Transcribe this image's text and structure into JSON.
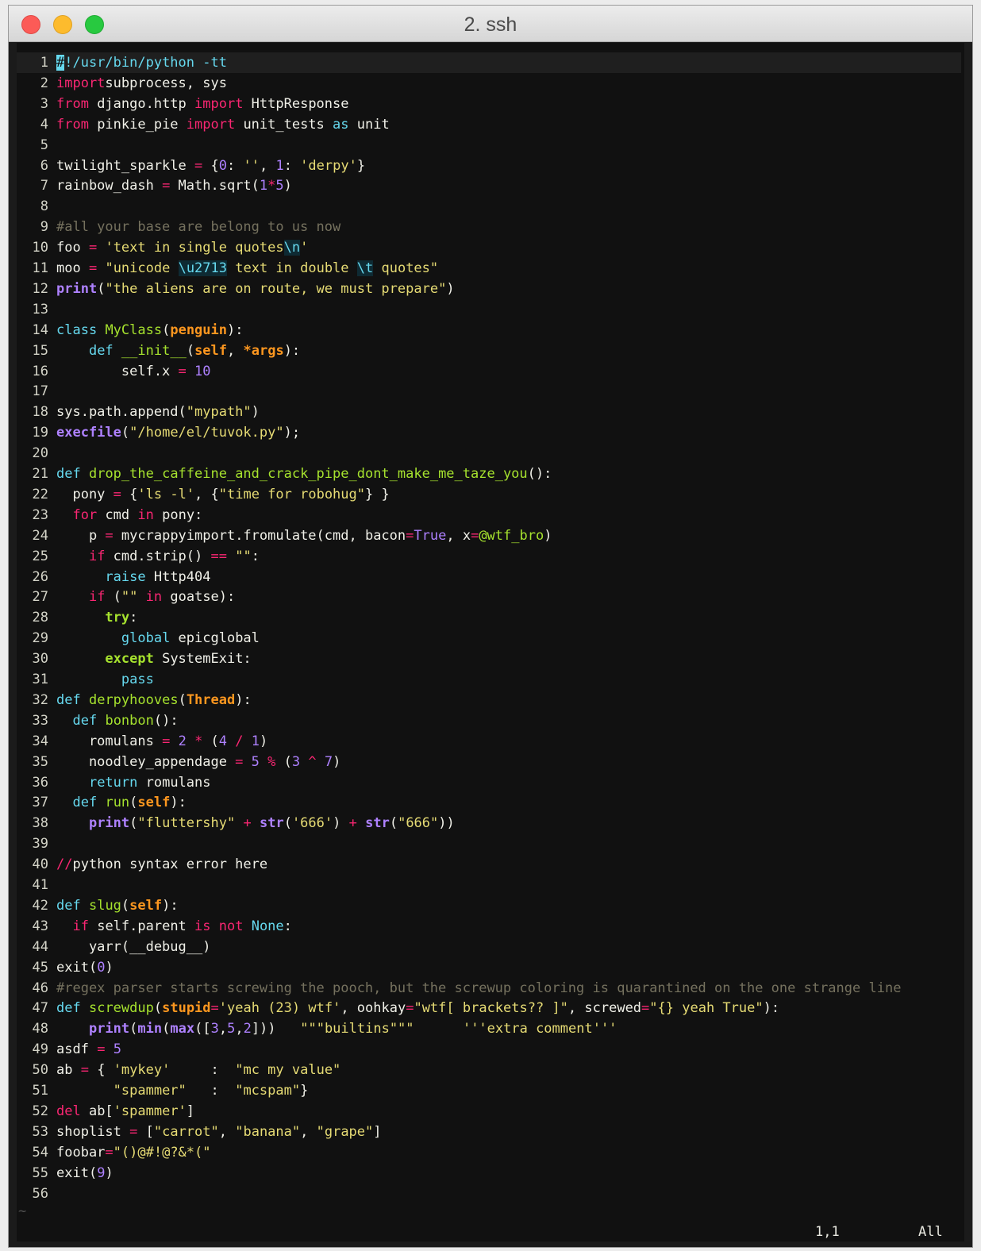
{
  "window": {
    "title": "2. ssh"
  },
  "editor": {
    "status_position": "1,1",
    "status_scroll": "All",
    "empty_line_marker": "~",
    "lines": [
      [
        [
          "k",
          "#"
        ],
        [
          "b",
          "!/usr/bin/python -tt"
        ]
      ],
      [
        [
          "k",
          "import"
        ],
        [
          "",
          "subprocess, sys"
        ]
      ],
      [
        [
          "k",
          "from"
        ],
        [
          "",
          " django.http "
        ],
        [
          "k",
          "import"
        ],
        [
          "",
          " HttpResponse"
        ]
      ],
      [
        [
          "k",
          "from"
        ],
        [
          "",
          " pinkie_pie "
        ],
        [
          "k",
          "import"
        ],
        [
          "",
          " unit_tests "
        ],
        [
          "b",
          "as"
        ],
        [
          "",
          " unit"
        ]
      ],
      [],
      [
        [
          "",
          "twilight_sparkle "
        ],
        [
          "k",
          "="
        ],
        [
          "",
          " {"
        ],
        [
          "p",
          "0"
        ],
        [
          "",
          ": "
        ],
        [
          "s",
          "''"
        ],
        [
          "",
          ", "
        ],
        [
          "p",
          "1"
        ],
        [
          "",
          ": "
        ],
        [
          "s",
          "'derpy'"
        ],
        [
          "",
          "}"
        ]
      ],
      [
        [
          "",
          "rainbow_dash "
        ],
        [
          "k",
          "="
        ],
        [
          "",
          " Math.sqrt("
        ],
        [
          "p",
          "1"
        ],
        [
          "k",
          "*"
        ],
        [
          "p",
          "5"
        ],
        [
          "",
          ")"
        ]
      ],
      [],
      [
        [
          "c",
          "#all your base are belong to us now"
        ]
      ],
      [
        [
          "",
          "foo "
        ],
        [
          "k",
          "="
        ],
        [
          "",
          " "
        ],
        [
          "s",
          "'text in single quotes"
        ],
        [
          "esc",
          "\\n"
        ],
        [
          "s",
          "'"
        ]
      ],
      [
        [
          "",
          "moo "
        ],
        [
          "k",
          "="
        ],
        [
          "",
          " "
        ],
        [
          "s",
          "\"unicode "
        ],
        [
          "esc",
          "\\u2713"
        ],
        [
          "s",
          " text in double "
        ],
        [
          "esc",
          "\\t"
        ],
        [
          "s",
          " quotes\""
        ]
      ],
      [
        [
          "bp",
          "print"
        ],
        [
          "",
          "("
        ],
        [
          "s",
          "\"the aliens are on route, we must prepare\""
        ],
        [
          "",
          ")"
        ]
      ],
      [],
      [
        [
          "b",
          "class"
        ],
        [
          "",
          " "
        ],
        [
          "g",
          "MyClass"
        ],
        [
          "",
          "("
        ],
        [
          "o",
          "penguin"
        ],
        [
          "",
          "):"
        ]
      ],
      [
        [
          "",
          "    "
        ],
        [
          "b",
          "def"
        ],
        [
          "",
          " "
        ],
        [
          "g",
          "__init__"
        ],
        [
          "",
          "("
        ],
        [
          "o",
          "self"
        ],
        [
          "",
          ", "
        ],
        [
          "o",
          "*args"
        ],
        [
          "",
          "):"
        ]
      ],
      [
        [
          "",
          "        self.x "
        ],
        [
          "k",
          "="
        ],
        [
          "",
          " "
        ],
        [
          "p",
          "10"
        ]
      ],
      [],
      [
        [
          "",
          "sys.path.append("
        ],
        [
          "s",
          "\"mypath\""
        ],
        [
          "",
          ")"
        ]
      ],
      [
        [
          "bp",
          "execfile"
        ],
        [
          "",
          "("
        ],
        [
          "s",
          "\"/home/el/tuvok.py\""
        ],
        [
          "",
          ");"
        ]
      ],
      [],
      [
        [
          "b",
          "def"
        ],
        [
          "",
          " "
        ],
        [
          "g",
          "drop_the_caffeine_and_crack_pipe_dont_make_me_taze_you"
        ],
        [
          "",
          "():"
        ]
      ],
      [
        [
          "",
          "  pony "
        ],
        [
          "k",
          "="
        ],
        [
          "",
          " {"
        ],
        [
          "s",
          "'ls -l'"
        ],
        [
          "",
          ", {"
        ],
        [
          "s",
          "\"time for robohug\""
        ],
        [
          "",
          "} }"
        ]
      ],
      [
        [
          "",
          "  "
        ],
        [
          "k",
          "for"
        ],
        [
          "",
          " cmd "
        ],
        [
          "k",
          "in"
        ],
        [
          "",
          " pony:"
        ]
      ],
      [
        [
          "",
          "    p "
        ],
        [
          "k",
          "="
        ],
        [
          "",
          " mycrappyimport.fromulate(cmd, bacon"
        ],
        [
          "k",
          "="
        ],
        [
          "p",
          "True"
        ],
        [
          "",
          ", x"
        ],
        [
          "k",
          "="
        ],
        [
          "g",
          "@wtf_bro"
        ],
        [
          "",
          ")"
        ]
      ],
      [
        [
          "",
          "    "
        ],
        [
          "k",
          "if"
        ],
        [
          "",
          " cmd.strip() "
        ],
        [
          "k",
          "=="
        ],
        [
          "",
          " "
        ],
        [
          "s",
          "\"\""
        ],
        [
          "",
          ":"
        ]
      ],
      [
        [
          "",
          "      "
        ],
        [
          "b",
          "raise"
        ],
        [
          "",
          " Http404"
        ]
      ],
      [
        [
          "",
          "    "
        ],
        [
          "k",
          "if"
        ],
        [
          "",
          " ("
        ],
        [
          "s",
          "\"\""
        ],
        [
          "",
          " "
        ],
        [
          "k",
          "in"
        ],
        [
          "",
          " goatse):"
        ]
      ],
      [
        [
          "",
          "      "
        ],
        [
          "bg",
          "try"
        ],
        [
          "",
          ":"
        ]
      ],
      [
        [
          "",
          "        "
        ],
        [
          "b",
          "global"
        ],
        [
          "",
          " epicglobal"
        ]
      ],
      [
        [
          "",
          "      "
        ],
        [
          "bg",
          "except"
        ],
        [
          "",
          " SystemExit:"
        ]
      ],
      [
        [
          "",
          "        "
        ],
        [
          "b",
          "pass"
        ]
      ],
      [
        [
          "b",
          "def"
        ],
        [
          "",
          " "
        ],
        [
          "g",
          "derpyhooves"
        ],
        [
          "",
          "("
        ],
        [
          "o",
          "Thread"
        ],
        [
          "",
          "):"
        ]
      ],
      [
        [
          "",
          "  "
        ],
        [
          "b",
          "def"
        ],
        [
          "",
          " "
        ],
        [
          "g",
          "bonbon"
        ],
        [
          "",
          "():"
        ]
      ],
      [
        [
          "",
          "    romulans "
        ],
        [
          "k",
          "="
        ],
        [
          "",
          " "
        ],
        [
          "p",
          "2"
        ],
        [
          "",
          " "
        ],
        [
          "k",
          "*"
        ],
        [
          "",
          " ("
        ],
        [
          "p",
          "4"
        ],
        [
          "",
          " "
        ],
        [
          "k",
          "/"
        ],
        [
          "",
          " "
        ],
        [
          "p",
          "1"
        ],
        [
          "",
          ")"
        ]
      ],
      [
        [
          "",
          "    noodley_appendage "
        ],
        [
          "k",
          "="
        ],
        [
          "",
          " "
        ],
        [
          "p",
          "5"
        ],
        [
          "",
          " "
        ],
        [
          "k",
          "%"
        ],
        [
          "",
          " ("
        ],
        [
          "p",
          "3"
        ],
        [
          "",
          " "
        ],
        [
          "k",
          "^"
        ],
        [
          "",
          " "
        ],
        [
          "p",
          "7"
        ],
        [
          "",
          ")"
        ]
      ],
      [
        [
          "",
          "    "
        ],
        [
          "b",
          "return"
        ],
        [
          "",
          " romulans"
        ]
      ],
      [
        [
          "",
          "  "
        ],
        [
          "b",
          "def"
        ],
        [
          "",
          " "
        ],
        [
          "g",
          "run"
        ],
        [
          "",
          "("
        ],
        [
          "o",
          "self"
        ],
        [
          "",
          "):"
        ]
      ],
      [
        [
          "",
          "    "
        ],
        [
          "bp",
          "print"
        ],
        [
          "",
          "("
        ],
        [
          "s",
          "\"fluttershy\""
        ],
        [
          "",
          " "
        ],
        [
          "k",
          "+"
        ],
        [
          "",
          " "
        ],
        [
          "bp",
          "str"
        ],
        [
          "",
          "("
        ],
        [
          "s",
          "'666'"
        ],
        [
          "",
          ") "
        ],
        [
          "k",
          "+"
        ],
        [
          "",
          " "
        ],
        [
          "bp",
          "str"
        ],
        [
          "",
          "("
        ],
        [
          "s",
          "\"666\""
        ],
        [
          "",
          "))"
        ]
      ],
      [],
      [
        [
          "k",
          "//"
        ],
        [
          "",
          "python syntax error here"
        ]
      ],
      [],
      [
        [
          "b",
          "def"
        ],
        [
          "",
          " "
        ],
        [
          "g",
          "slug"
        ],
        [
          "",
          "("
        ],
        [
          "o",
          "self"
        ],
        [
          "",
          "):"
        ]
      ],
      [
        [
          "",
          "  "
        ],
        [
          "k",
          "if"
        ],
        [
          "",
          " self.parent "
        ],
        [
          "k",
          "is not"
        ],
        [
          "",
          " "
        ],
        [
          "b",
          "None"
        ],
        [
          "",
          ":"
        ]
      ],
      [
        [
          "",
          "    yarr(__debug__)"
        ]
      ],
      [
        [
          "",
          "exit("
        ],
        [
          "p",
          "0"
        ],
        [
          "",
          ")"
        ]
      ],
      [
        [
          "c",
          "#regex parser starts screwing the pooch, but the screwup coloring is quarantined on the one strange line"
        ]
      ],
      [
        [
          "b",
          "def"
        ],
        [
          "",
          " "
        ],
        [
          "g",
          "screwdup"
        ],
        [
          "",
          "("
        ],
        [
          "o",
          "stupid"
        ],
        [
          "k",
          "="
        ],
        [
          "s",
          "'yeah (23) wtf'"
        ],
        [
          "",
          ", oohkay"
        ],
        [
          "k",
          "="
        ],
        [
          "s",
          "\"wtf[ brackets?? ]\""
        ],
        [
          "",
          ", screwed"
        ],
        [
          "k",
          "="
        ],
        [
          "s",
          "\"{} yeah True\""
        ],
        [
          "",
          "):"
        ]
      ],
      [
        [
          "",
          "    "
        ],
        [
          "bp",
          "print"
        ],
        [
          "",
          "("
        ],
        [
          "bp",
          "min"
        ],
        [
          "",
          "("
        ],
        [
          "bp",
          "max"
        ],
        [
          "",
          "(["
        ],
        [
          "p",
          "3"
        ],
        [
          "",
          ","
        ],
        [
          "p",
          "5"
        ],
        [
          "",
          ","
        ],
        [
          "p",
          "2"
        ],
        [
          "",
          "]))   "
        ],
        [
          "s",
          "\"\"\"builtins\"\"\""
        ],
        [
          "",
          "      "
        ],
        [
          "s",
          "'''extra comment'''"
        ]
      ],
      [
        [
          "",
          "asdf "
        ],
        [
          "k",
          "="
        ],
        [
          "",
          " "
        ],
        [
          "p",
          "5"
        ]
      ],
      [
        [
          "",
          "ab "
        ],
        [
          "k",
          "="
        ],
        [
          "",
          " { "
        ],
        [
          "s",
          "'mykey'"
        ],
        [
          "",
          "     :  "
        ],
        [
          "s",
          "\"mc my value\""
        ]
      ],
      [
        [
          "",
          "       "
        ],
        [
          "s",
          "\"spammer\""
        ],
        [
          "",
          "   :  "
        ],
        [
          "s",
          "\"mcspam\""
        ],
        [
          "",
          "}"
        ]
      ],
      [
        [
          "k",
          "del"
        ],
        [
          "",
          " ab["
        ],
        [
          "s",
          "'spammer'"
        ],
        [
          "",
          "]"
        ]
      ],
      [
        [
          "",
          "shoplist "
        ],
        [
          "k",
          "="
        ],
        [
          "",
          " ["
        ],
        [
          "s",
          "\"carrot\""
        ],
        [
          "",
          ", "
        ],
        [
          "s",
          "\"banana\""
        ],
        [
          "",
          ", "
        ],
        [
          "s",
          "\"grape\""
        ],
        [
          "",
          "]"
        ]
      ],
      [
        [
          "",
          "foobar"
        ],
        [
          "k",
          "="
        ],
        [
          "s",
          "\"()@#!@?&*(\""
        ]
      ],
      [
        [
          "",
          "exit("
        ],
        [
          "p",
          "9"
        ],
        [
          "",
          ")"
        ]
      ],
      []
    ]
  }
}
